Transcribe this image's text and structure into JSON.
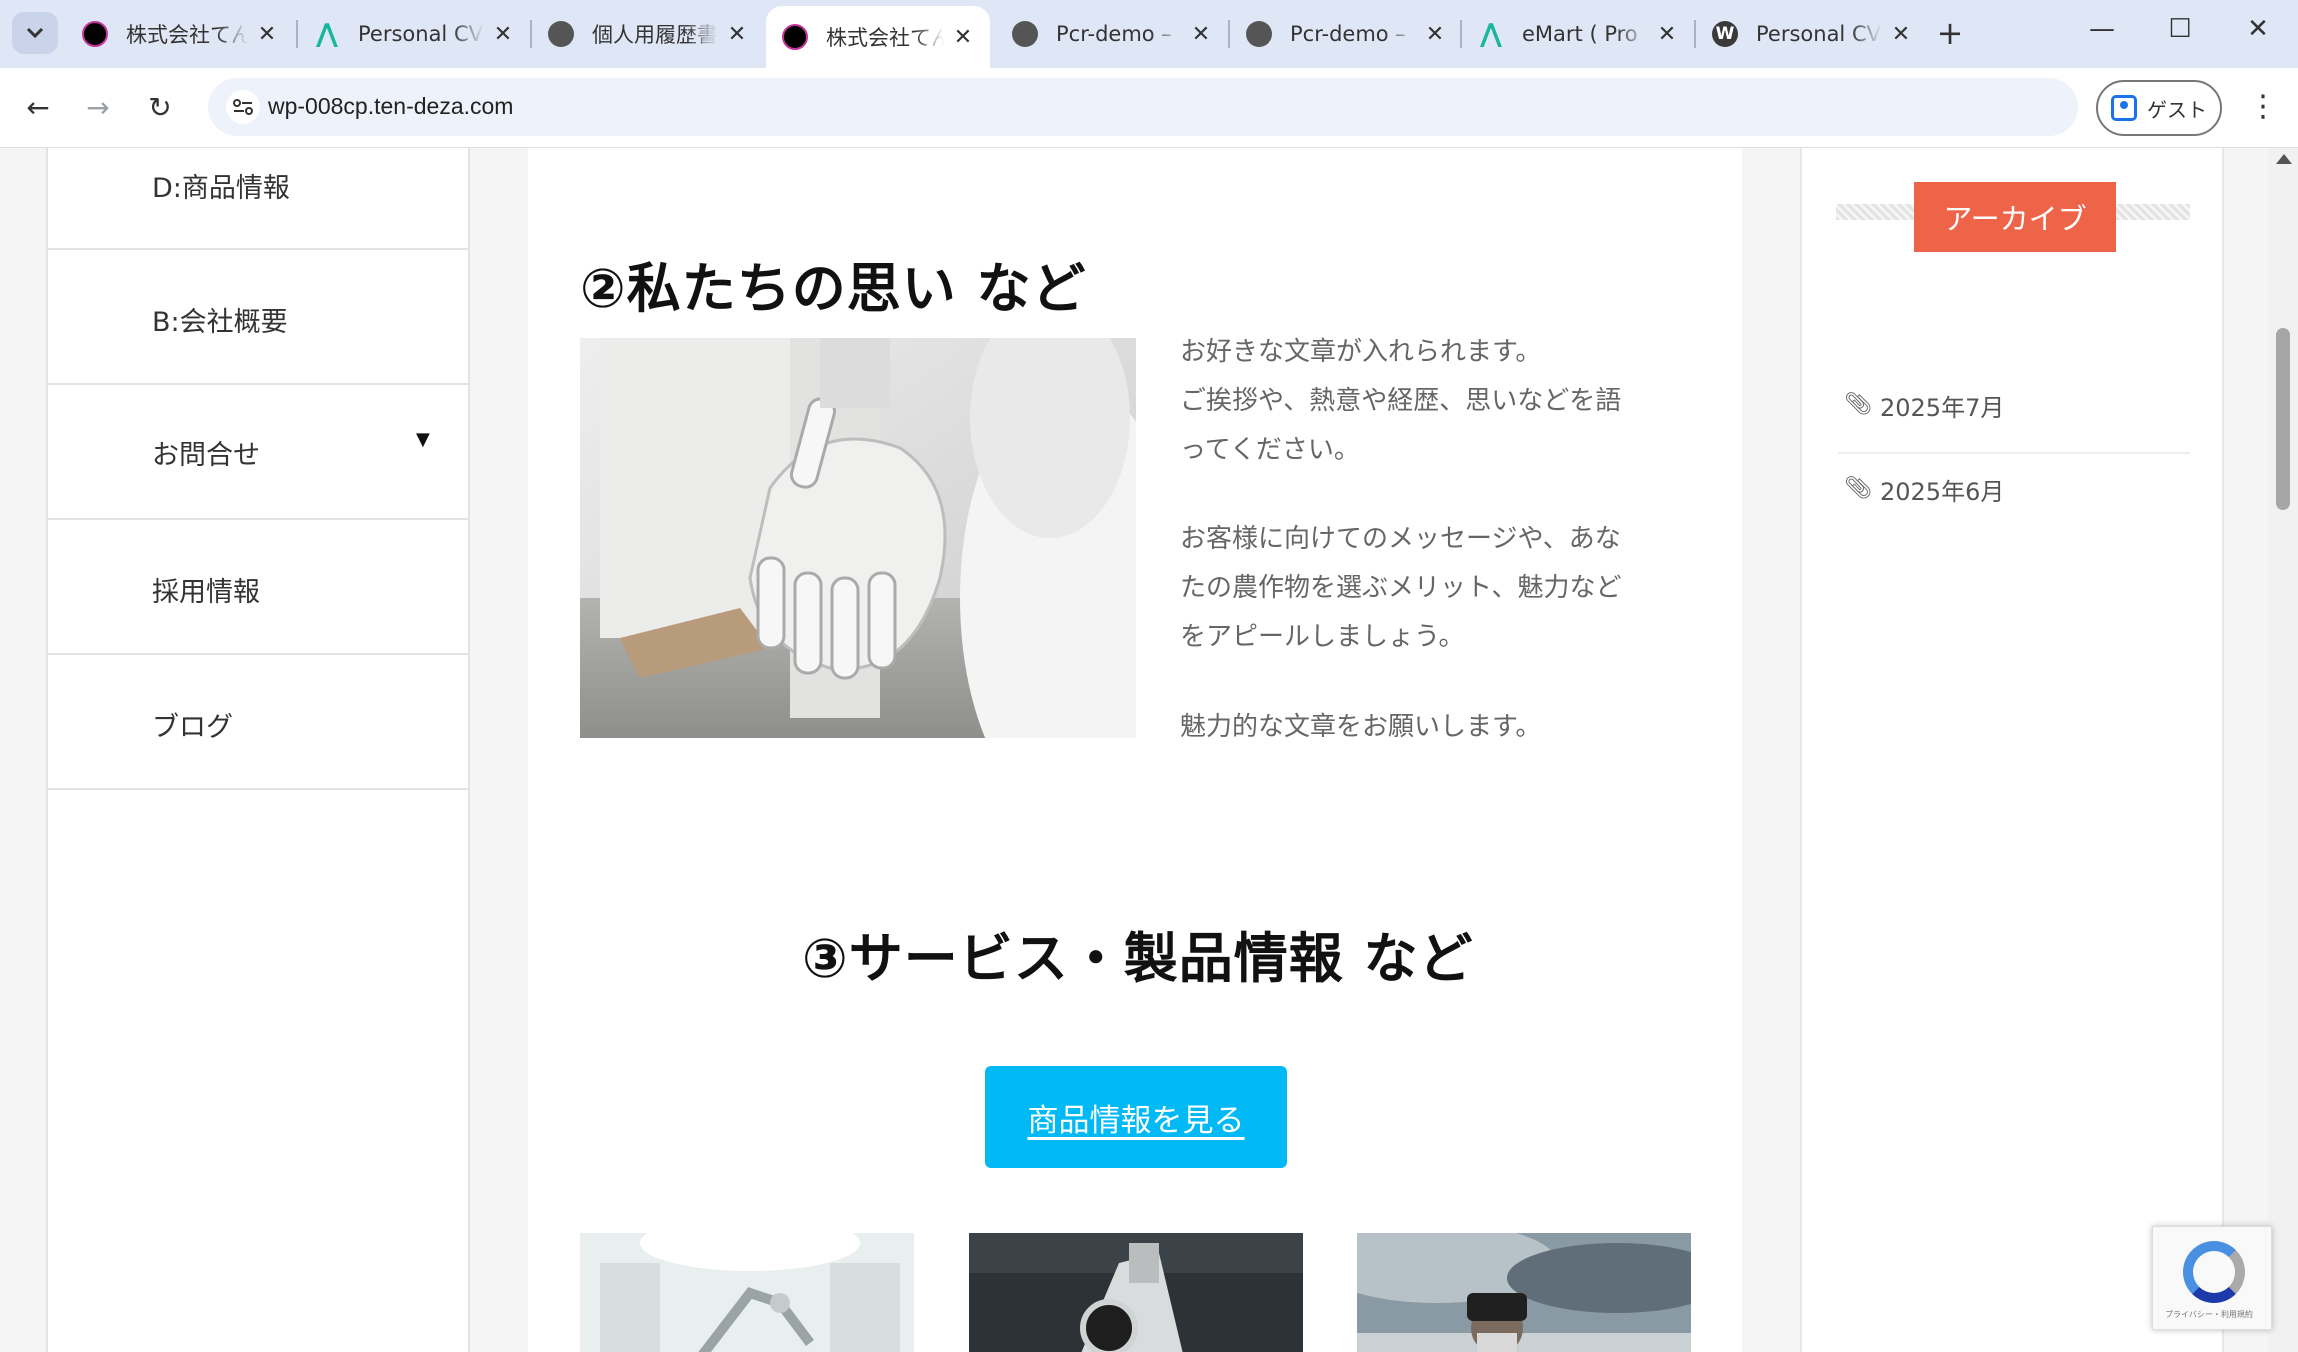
{
  "browser": {
    "tabs": [
      {
        "title": "株式会社てんデザ",
        "favicon": "site-logo",
        "active": false
      },
      {
        "title": "Personal CV",
        "favicon": "astra-logo",
        "active": false
      },
      {
        "title": "個人用履歴書",
        "favicon": "globe-icon",
        "active": false
      },
      {
        "title": "株式会社てんデザ",
        "favicon": "site-logo",
        "active": true
      },
      {
        "title": "Pcr-demo –",
        "favicon": "globe-icon",
        "active": false
      },
      {
        "title": "Pcr-demo –",
        "favicon": "globe-icon",
        "active": false
      },
      {
        "title": "eMart ( Pro )",
        "favicon": "astra-logo",
        "active": false
      },
      {
        "title": "Personal CV",
        "favicon": "wordpress-logo",
        "active": false
      }
    ],
    "url": "wp-008cp.ten-deza.com",
    "profile_label": "ゲスト"
  },
  "left_nav": {
    "items": [
      {
        "label": "D:商品情報"
      },
      {
        "label": "B:会社概要"
      },
      {
        "label": "お問合せ",
        "has_submenu": true
      },
      {
        "label": "採用情報"
      },
      {
        "label": "ブログ"
      }
    ]
  },
  "main": {
    "section2": {
      "heading": "②私たちの思い など",
      "paragraphs": [
        [
          "お好きな文章が入れられます。",
          "ご挨拶や、熱意や経歴、思いなどを語",
          "ってください。"
        ],
        [
          "お客様に向けてのメッセージや、あな",
          "たの農作物を選ぶメリット、魅力など",
          "をアピールしましょう。"
        ],
        [
          "魅力的な文章をお願いします。"
        ]
      ]
    },
    "section3": {
      "heading": "③サービス・製品情報 など",
      "button_label": "商品情報を見る"
    }
  },
  "sidebar": {
    "archive_title": "アーカイブ",
    "archive_items": [
      "2025年7月",
      "2025年6月"
    ]
  },
  "recaptcha": {
    "text": "プライバシー・利用規約"
  },
  "colors": {
    "accent_button": "#00b9f5",
    "archive_badge": "#ee6449"
  }
}
